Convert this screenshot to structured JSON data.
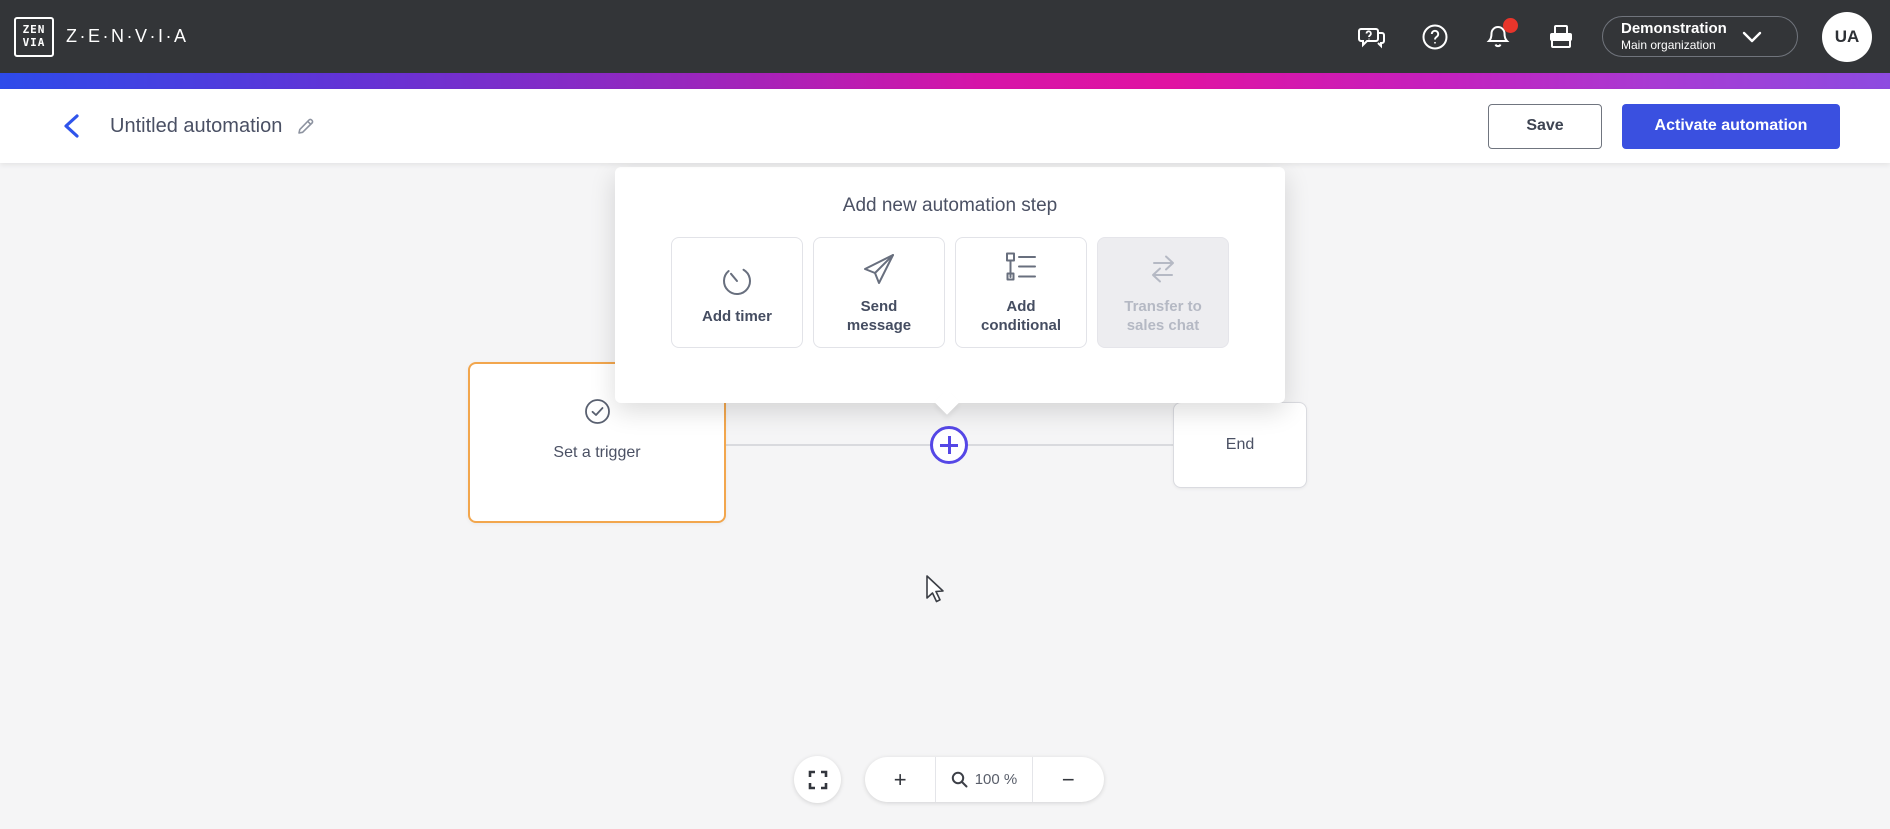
{
  "topbar": {
    "logo_line1": "ZEN",
    "logo_line2": "VIA",
    "brand_text": "Z·E·N·V·I·A",
    "org": {
      "name": "Demonstration",
      "subtitle": "Main organization"
    },
    "avatar_initials": "UA",
    "notifications_unread": true
  },
  "header": {
    "title": "Untitled automation",
    "save_label": "Save",
    "activate_label": "Activate automation"
  },
  "popup": {
    "title": "Add new automation step",
    "options": [
      {
        "label": "Add timer",
        "icon": "timer-icon",
        "disabled": false
      },
      {
        "label": "Send message",
        "icon": "paper-plane-icon",
        "disabled": false
      },
      {
        "label": "Add conditional",
        "icon": "conditional-tree-icon",
        "disabled": false
      },
      {
        "label": "Transfer to sales chat",
        "icon": "swap-arrows-icon",
        "disabled": true
      }
    ]
  },
  "canvas": {
    "trigger_label": "Set a trigger",
    "end_label": "End"
  },
  "zoom_controls": {
    "plus_label": "+",
    "minus_label": "−",
    "level": "100 %"
  },
  "colors": {
    "topbar_bg": "#333538",
    "accent_blue": "#3a50e0",
    "plus_purple": "#5547e6",
    "trigger_border": "#f2a64d",
    "badge_red": "#e8352b",
    "gradient": [
      "#2d4bea",
      "#9727be",
      "#e013a2",
      "#8d4be0"
    ]
  }
}
